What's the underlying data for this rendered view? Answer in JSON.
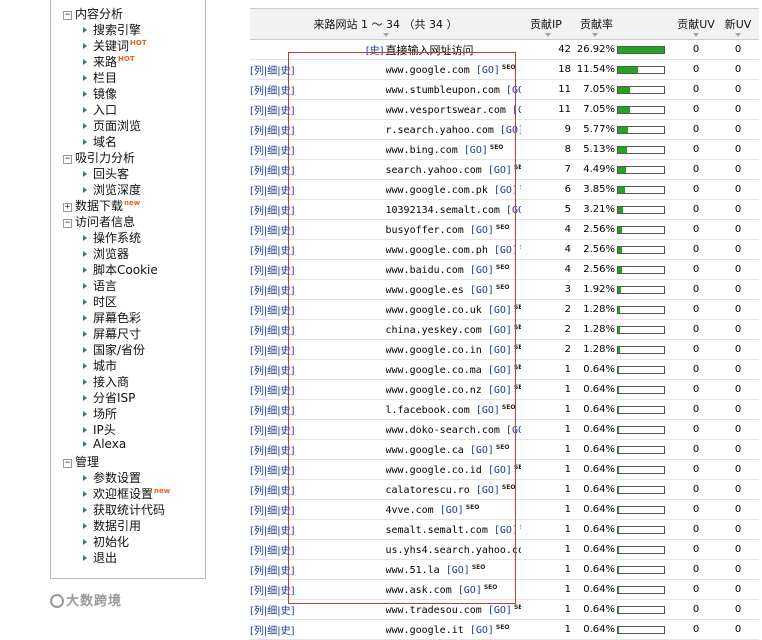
{
  "sidebar": {
    "groups": [
      {
        "label": "内容分析",
        "items": [
          {
            "label": "搜索引擎",
            "badge": ""
          },
          {
            "label": "关键词",
            "badge": "HOT"
          },
          {
            "label": "来路",
            "badge": "HOT"
          },
          {
            "label": "栏目",
            "badge": ""
          },
          {
            "label": "镜像",
            "badge": ""
          },
          {
            "label": "入口",
            "badge": ""
          },
          {
            "label": "页面浏览",
            "badge": ""
          },
          {
            "label": "域名",
            "badge": ""
          }
        ]
      },
      {
        "label": "吸引力分析",
        "items": [
          {
            "label": "回头客",
            "badge": ""
          },
          {
            "label": "浏览深度",
            "badge": ""
          }
        ]
      },
      {
        "label": "数据下载",
        "badge": "new",
        "items": []
      },
      {
        "label": "访问者信息",
        "items": [
          {
            "label": "操作系统",
            "badge": ""
          },
          {
            "label": "浏览器",
            "badge": ""
          },
          {
            "label": "脚本Cookie",
            "badge": ""
          },
          {
            "label": "语言",
            "badge": ""
          },
          {
            "label": "时区",
            "badge": ""
          },
          {
            "label": "屏幕色彩",
            "badge": ""
          },
          {
            "label": "屏幕尺寸",
            "badge": ""
          },
          {
            "label": "国家/省份",
            "badge": ""
          },
          {
            "label": "城市",
            "badge": ""
          },
          {
            "label": "接入商",
            "badge": ""
          },
          {
            "label": "分省ISP",
            "badge": ""
          },
          {
            "label": "场所",
            "badge": ""
          },
          {
            "label": "IP头",
            "badge": ""
          },
          {
            "label": "Alexa",
            "badge": ""
          }
        ]
      },
      {
        "label": "管理",
        "items": [
          {
            "label": "参数设置",
            "badge": ""
          },
          {
            "label": "欢迎框设置",
            "badge": "new"
          },
          {
            "label": "获取统计代码",
            "badge": ""
          },
          {
            "label": "数据引用",
            "badge": ""
          },
          {
            "label": "初始化",
            "badge": ""
          },
          {
            "label": "退出",
            "badge": ""
          }
        ]
      }
    ]
  },
  "table": {
    "headers": {
      "site": "来路网站 1 ～ 34 （共 34 ）",
      "ip": "贡献IP",
      "rate": "贡献率",
      "uv": "贡献UV",
      "new_uv": "新UV"
    },
    "link_labels": {
      "list": "列",
      "detail": "细",
      "history": "史",
      "go": "[GO]",
      "seo": "SEO"
    },
    "direct_row": {
      "label": "直接输入网址访问",
      "ip": "42",
      "rate": "26.92%",
      "rate_value": 26.92,
      "uv": "0",
      "new_uv": "0"
    },
    "rows": [
      {
        "site": "www.google.com",
        "ip": "18",
        "rate": "11.54%",
        "rate_value": 11.54,
        "uv": "0",
        "new_uv": "0"
      },
      {
        "site": "www.stumbleupon.com",
        "ip": "11",
        "rate": "7.05%",
        "rate_value": 7.05,
        "uv": "0",
        "new_uv": "0"
      },
      {
        "site": "www.vesportswear.com",
        "ip": "11",
        "rate": "7.05%",
        "rate_value": 7.05,
        "uv": "0",
        "new_uv": "0"
      },
      {
        "site": "r.search.yahoo.com",
        "ip": "9",
        "rate": "5.77%",
        "rate_value": 5.77,
        "uv": "0",
        "new_uv": "0"
      },
      {
        "site": "www.bing.com",
        "ip": "8",
        "rate": "5.13%",
        "rate_value": 5.13,
        "uv": "0",
        "new_uv": "0"
      },
      {
        "site": "search.yahoo.com",
        "ip": "7",
        "rate": "4.49%",
        "rate_value": 4.49,
        "uv": "0",
        "new_uv": "0"
      },
      {
        "site": "www.google.com.pk",
        "ip": "6",
        "rate": "3.85%",
        "rate_value": 3.85,
        "uv": "0",
        "new_uv": "0"
      },
      {
        "site": "10392134.semalt.com",
        "ip": "5",
        "rate": "3.21%",
        "rate_value": 3.21,
        "uv": "0",
        "new_uv": "0"
      },
      {
        "site": "busyoffer.com",
        "ip": "4",
        "rate": "2.56%",
        "rate_value": 2.56,
        "uv": "0",
        "new_uv": "0"
      },
      {
        "site": "www.google.com.ph",
        "ip": "4",
        "rate": "2.56%",
        "rate_value": 2.56,
        "uv": "0",
        "new_uv": "0"
      },
      {
        "site": "www.baidu.com",
        "ip": "4",
        "rate": "2.56%",
        "rate_value": 2.56,
        "uv": "0",
        "new_uv": "0"
      },
      {
        "site": "www.google.es",
        "ip": "3",
        "rate": "1.92%",
        "rate_value": 1.92,
        "uv": "0",
        "new_uv": "0"
      },
      {
        "site": "www.google.co.uk",
        "ip": "2",
        "rate": "1.28%",
        "rate_value": 1.28,
        "uv": "0",
        "new_uv": "0"
      },
      {
        "site": "china.yeskey.com",
        "ip": "2",
        "rate": "1.28%",
        "rate_value": 1.28,
        "uv": "0",
        "new_uv": "0"
      },
      {
        "site": "www.google.co.in",
        "ip": "2",
        "rate": "1.28%",
        "rate_value": 1.28,
        "uv": "0",
        "new_uv": "0"
      },
      {
        "site": "www.google.co.ma",
        "ip": "1",
        "rate": "0.64%",
        "rate_value": 0.64,
        "uv": "0",
        "new_uv": "0"
      },
      {
        "site": "www.google.co.nz",
        "ip": "1",
        "rate": "0.64%",
        "rate_value": 0.64,
        "uv": "0",
        "new_uv": "0"
      },
      {
        "site": "l.facebook.com",
        "ip": "1",
        "rate": "0.64%",
        "rate_value": 0.64,
        "uv": "0",
        "new_uv": "0"
      },
      {
        "site": "www.doko-search.com",
        "ip": "1",
        "rate": "0.64%",
        "rate_value": 0.64,
        "uv": "0",
        "new_uv": "0"
      },
      {
        "site": "www.google.ca",
        "ip": "1",
        "rate": "0.64%",
        "rate_value": 0.64,
        "uv": "0",
        "new_uv": "0"
      },
      {
        "site": "www.google.co.id",
        "ip": "1",
        "rate": "0.64%",
        "rate_value": 0.64,
        "uv": "0",
        "new_uv": "0"
      },
      {
        "site": "calatorescu.ro",
        "ip": "1",
        "rate": "0.64%",
        "rate_value": 0.64,
        "uv": "0",
        "new_uv": "0"
      },
      {
        "site": "4vve.com",
        "ip": "1",
        "rate": "0.64%",
        "rate_value": 0.64,
        "uv": "0",
        "new_uv": "0"
      },
      {
        "site": "semalt.semalt.com",
        "ip": "1",
        "rate": "0.64%",
        "rate_value": 0.64,
        "uv": "0",
        "new_uv": "0"
      },
      {
        "site": "us.yhs4.search.yahoo.com",
        "ip": "1",
        "rate": "0.64%",
        "rate_value": 0.64,
        "uv": "0",
        "new_uv": "0"
      },
      {
        "site": "www.51.la",
        "ip": "1",
        "rate": "0.64%",
        "rate_value": 0.64,
        "uv": "0",
        "new_uv": "0"
      },
      {
        "site": "www.ask.com",
        "ip": "1",
        "rate": "0.64%",
        "rate_value": 0.64,
        "uv": "0",
        "new_uv": "0"
      },
      {
        "site": "www.tradesou.com",
        "ip": "1",
        "rate": "0.64%",
        "rate_value": 0.64,
        "uv": "0",
        "new_uv": "0"
      },
      {
        "site": "www.google.it",
        "ip": "1",
        "rate": "0.64%",
        "rate_value": 0.64,
        "uv": "0",
        "new_uv": "0"
      }
    ]
  },
  "watermark": {
    "text": "大数跨境"
  },
  "colors": {
    "bar_fill": "#1fa51f",
    "link": "#1a3a9e",
    "badge": "#e8641b",
    "highlight_border": "#c23b3b"
  }
}
